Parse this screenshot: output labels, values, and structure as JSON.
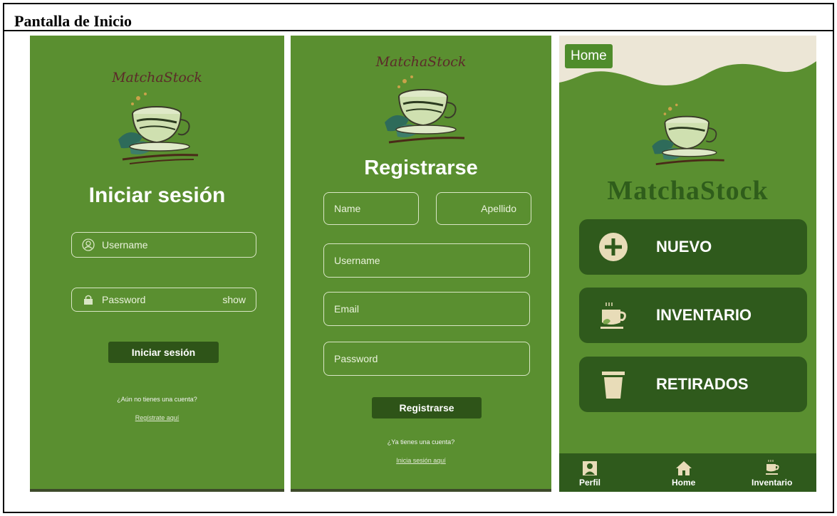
{
  "header": {
    "title": "Pantalla de Inicio"
  },
  "brand": {
    "logo_text": "MatchaStock"
  },
  "login": {
    "title": "Iniciar sesión",
    "username_placeholder": "Username",
    "password_placeholder": "Password",
    "show_label": "show",
    "submit_label": "Iniciar sesión",
    "no_account_text": "¿Aún no tienes una cuenta?",
    "register_link": "Regístrate aquí"
  },
  "register": {
    "title": "Registrarse",
    "name_placeholder": "Name",
    "lastname_placeholder": "Apellido",
    "username_placeholder": "Username",
    "email_placeholder": "Email",
    "password_placeholder": "Password",
    "submit_label": "Registrarse",
    "have_account_text": "¿Ya tienes una cuenta?",
    "login_link": "Inicia sesión aquí"
  },
  "home": {
    "chip_label": "Home",
    "brand_title": "MatchaStock",
    "menu": [
      {
        "label": "NUEVO",
        "icon": "plus-circle-icon"
      },
      {
        "label": "INVENTARIO",
        "icon": "tea-cup-icon"
      },
      {
        "label": "RETIRADOS",
        "icon": "trash-icon"
      }
    ],
    "nav": [
      {
        "label": "Perfil",
        "icon": "profile-icon"
      },
      {
        "label": "Home",
        "icon": "house-icon"
      },
      {
        "label": "Inventario",
        "icon": "tea-cup-icon"
      }
    ]
  },
  "colors": {
    "screen_green": "#5a8f30",
    "dark_green": "#2f5a1c",
    "brand_maroon": "#5c2a2a",
    "cream": "#ece6d6"
  }
}
